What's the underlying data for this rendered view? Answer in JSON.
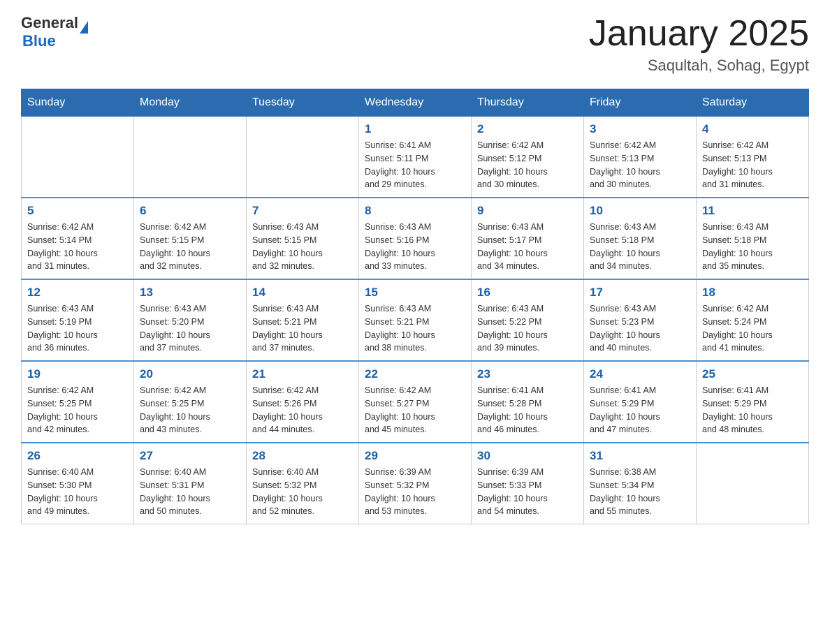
{
  "header": {
    "logo": {
      "general": "General",
      "blue": "Blue"
    },
    "title": "January 2025",
    "subtitle": "Saqultah, Sohag, Egypt"
  },
  "days_of_week": [
    "Sunday",
    "Monday",
    "Tuesday",
    "Wednesday",
    "Thursday",
    "Friday",
    "Saturday"
  ],
  "weeks": [
    [
      {
        "day": "",
        "info": ""
      },
      {
        "day": "",
        "info": ""
      },
      {
        "day": "",
        "info": ""
      },
      {
        "day": "1",
        "info": "Sunrise: 6:41 AM\nSunset: 5:11 PM\nDaylight: 10 hours\nand 29 minutes."
      },
      {
        "day": "2",
        "info": "Sunrise: 6:42 AM\nSunset: 5:12 PM\nDaylight: 10 hours\nand 30 minutes."
      },
      {
        "day": "3",
        "info": "Sunrise: 6:42 AM\nSunset: 5:13 PM\nDaylight: 10 hours\nand 30 minutes."
      },
      {
        "day": "4",
        "info": "Sunrise: 6:42 AM\nSunset: 5:13 PM\nDaylight: 10 hours\nand 31 minutes."
      }
    ],
    [
      {
        "day": "5",
        "info": "Sunrise: 6:42 AM\nSunset: 5:14 PM\nDaylight: 10 hours\nand 31 minutes."
      },
      {
        "day": "6",
        "info": "Sunrise: 6:42 AM\nSunset: 5:15 PM\nDaylight: 10 hours\nand 32 minutes."
      },
      {
        "day": "7",
        "info": "Sunrise: 6:43 AM\nSunset: 5:15 PM\nDaylight: 10 hours\nand 32 minutes."
      },
      {
        "day": "8",
        "info": "Sunrise: 6:43 AM\nSunset: 5:16 PM\nDaylight: 10 hours\nand 33 minutes."
      },
      {
        "day": "9",
        "info": "Sunrise: 6:43 AM\nSunset: 5:17 PM\nDaylight: 10 hours\nand 34 minutes."
      },
      {
        "day": "10",
        "info": "Sunrise: 6:43 AM\nSunset: 5:18 PM\nDaylight: 10 hours\nand 34 minutes."
      },
      {
        "day": "11",
        "info": "Sunrise: 6:43 AM\nSunset: 5:18 PM\nDaylight: 10 hours\nand 35 minutes."
      }
    ],
    [
      {
        "day": "12",
        "info": "Sunrise: 6:43 AM\nSunset: 5:19 PM\nDaylight: 10 hours\nand 36 minutes."
      },
      {
        "day": "13",
        "info": "Sunrise: 6:43 AM\nSunset: 5:20 PM\nDaylight: 10 hours\nand 37 minutes."
      },
      {
        "day": "14",
        "info": "Sunrise: 6:43 AM\nSunset: 5:21 PM\nDaylight: 10 hours\nand 37 minutes."
      },
      {
        "day": "15",
        "info": "Sunrise: 6:43 AM\nSunset: 5:21 PM\nDaylight: 10 hours\nand 38 minutes."
      },
      {
        "day": "16",
        "info": "Sunrise: 6:43 AM\nSunset: 5:22 PM\nDaylight: 10 hours\nand 39 minutes."
      },
      {
        "day": "17",
        "info": "Sunrise: 6:43 AM\nSunset: 5:23 PM\nDaylight: 10 hours\nand 40 minutes."
      },
      {
        "day": "18",
        "info": "Sunrise: 6:42 AM\nSunset: 5:24 PM\nDaylight: 10 hours\nand 41 minutes."
      }
    ],
    [
      {
        "day": "19",
        "info": "Sunrise: 6:42 AM\nSunset: 5:25 PM\nDaylight: 10 hours\nand 42 minutes."
      },
      {
        "day": "20",
        "info": "Sunrise: 6:42 AM\nSunset: 5:25 PM\nDaylight: 10 hours\nand 43 minutes."
      },
      {
        "day": "21",
        "info": "Sunrise: 6:42 AM\nSunset: 5:26 PM\nDaylight: 10 hours\nand 44 minutes."
      },
      {
        "day": "22",
        "info": "Sunrise: 6:42 AM\nSunset: 5:27 PM\nDaylight: 10 hours\nand 45 minutes."
      },
      {
        "day": "23",
        "info": "Sunrise: 6:41 AM\nSunset: 5:28 PM\nDaylight: 10 hours\nand 46 minutes."
      },
      {
        "day": "24",
        "info": "Sunrise: 6:41 AM\nSunset: 5:29 PM\nDaylight: 10 hours\nand 47 minutes."
      },
      {
        "day": "25",
        "info": "Sunrise: 6:41 AM\nSunset: 5:29 PM\nDaylight: 10 hours\nand 48 minutes."
      }
    ],
    [
      {
        "day": "26",
        "info": "Sunrise: 6:40 AM\nSunset: 5:30 PM\nDaylight: 10 hours\nand 49 minutes."
      },
      {
        "day": "27",
        "info": "Sunrise: 6:40 AM\nSunset: 5:31 PM\nDaylight: 10 hours\nand 50 minutes."
      },
      {
        "day": "28",
        "info": "Sunrise: 6:40 AM\nSunset: 5:32 PM\nDaylight: 10 hours\nand 52 minutes."
      },
      {
        "day": "29",
        "info": "Sunrise: 6:39 AM\nSunset: 5:32 PM\nDaylight: 10 hours\nand 53 minutes."
      },
      {
        "day": "30",
        "info": "Sunrise: 6:39 AM\nSunset: 5:33 PM\nDaylight: 10 hours\nand 54 minutes."
      },
      {
        "day": "31",
        "info": "Sunrise: 6:38 AM\nSunset: 5:34 PM\nDaylight: 10 hours\nand 55 minutes."
      },
      {
        "day": "",
        "info": ""
      }
    ]
  ]
}
